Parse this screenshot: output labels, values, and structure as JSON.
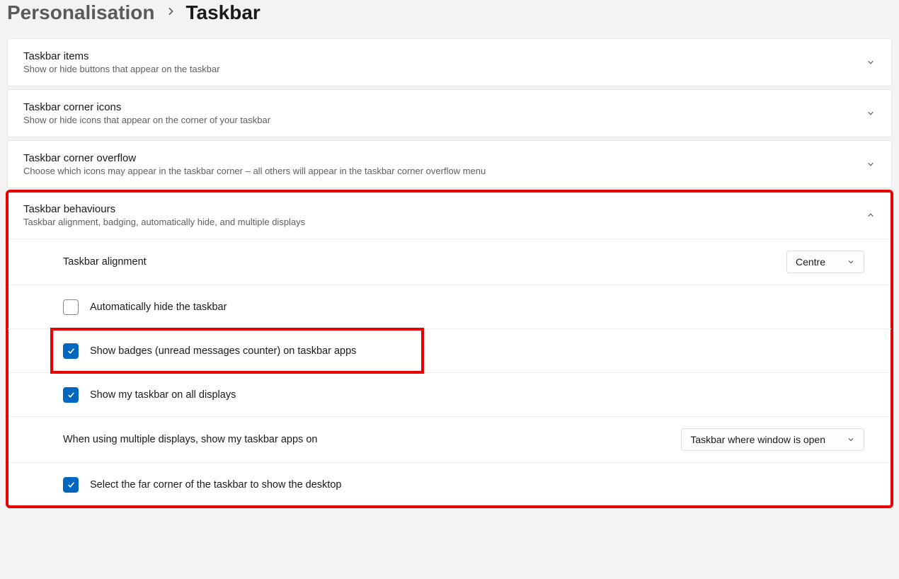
{
  "breadcrumb": {
    "parent": "Personalisation",
    "current": "Taskbar"
  },
  "sections": {
    "items": {
      "title": "Taskbar items",
      "subtitle": "Show or hide buttons that appear on the taskbar"
    },
    "corner_icons": {
      "title": "Taskbar corner icons",
      "subtitle": "Show or hide icons that appear on the corner of your taskbar"
    },
    "overflow": {
      "title": "Taskbar corner overflow",
      "subtitle": "Choose which icons may appear in the taskbar corner – all others will appear in the taskbar corner overflow menu"
    },
    "behaviours": {
      "title": "Taskbar behaviours",
      "subtitle": "Taskbar alignment, badging, automatically hide, and multiple displays",
      "alignment": {
        "label": "Taskbar alignment",
        "value": "Centre"
      },
      "auto_hide": {
        "label": "Automatically hide the taskbar",
        "checked": false
      },
      "badges": {
        "label": "Show badges (unread messages counter) on taskbar apps",
        "checked": true
      },
      "all_displays": {
        "label": "Show my taskbar on all displays",
        "checked": true
      },
      "multi_display": {
        "label": "When using multiple displays, show my taskbar apps on",
        "value": "Taskbar where window is open"
      },
      "far_corner": {
        "label": "Select the far corner of the taskbar to show the desktop",
        "checked": true
      }
    }
  }
}
